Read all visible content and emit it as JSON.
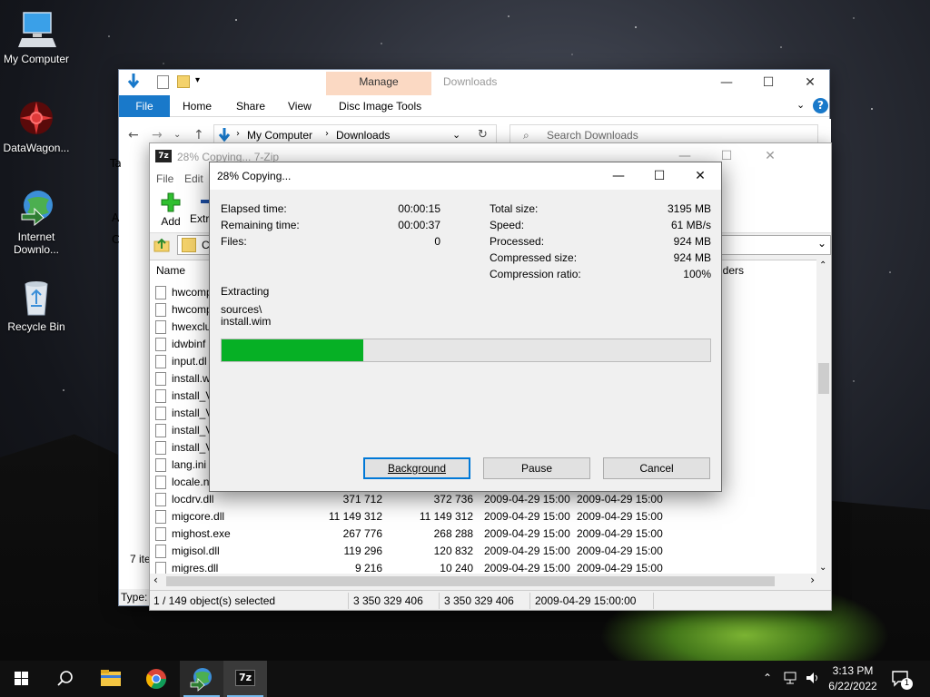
{
  "desktop": {
    "icons": [
      {
        "label": "My Computer"
      },
      {
        "label": "DataWagon..."
      },
      {
        "label": "Internet Downlo..."
      },
      {
        "label": "Recycle Bin"
      }
    ]
  },
  "explorer": {
    "title": "Downloads",
    "manage_label": "Manage",
    "tabs": [
      "File",
      "Home",
      "Share",
      "View",
      "Disc Image Tools"
    ],
    "breadcrumb": [
      "My Computer",
      "Downloads"
    ],
    "search_placeholder": "Search Downloads",
    "left_fragments": [
      "Ta",
      "A",
      "C"
    ],
    "status_left": "7 ite",
    "status_type": "Type:",
    "folders_fragment": "lders"
  },
  "sevenzip": {
    "title": "28% Copying... 7-Zip",
    "menu": [
      "File",
      "Edit"
    ],
    "toolbar": {
      "add": "Add",
      "extract": "Extr"
    },
    "path_fragment": "C",
    "column_name": "Name",
    "files": [
      {
        "name": "hwcomp",
        "size": "",
        "packed": "",
        "modified": "",
        "created": ""
      },
      {
        "name": "hwcomp",
        "size": "",
        "packed": "",
        "modified": "",
        "created": ""
      },
      {
        "name": "hwexclu",
        "size": "",
        "packed": "",
        "modified": "",
        "created": ""
      },
      {
        "name": "idwbinf",
        "size": "",
        "packed": "",
        "modified": "",
        "created": ""
      },
      {
        "name": "input.dl",
        "size": "",
        "packed": "",
        "modified": "",
        "created": ""
      },
      {
        "name": "install.w",
        "size": "",
        "packed": "",
        "modified": "",
        "created": ""
      },
      {
        "name": "install_V",
        "size": "",
        "packed": "",
        "modified": "",
        "created": ""
      },
      {
        "name": "install_V",
        "size": "",
        "packed": "",
        "modified": "",
        "created": ""
      },
      {
        "name": "install_V",
        "size": "",
        "packed": "",
        "modified": "",
        "created": ""
      },
      {
        "name": "install_V",
        "size": "",
        "packed": "",
        "modified": "",
        "created": ""
      },
      {
        "name": "lang.ini",
        "size": "",
        "packed": "",
        "modified": "",
        "created": ""
      },
      {
        "name": "locale.n",
        "size": "",
        "packed": "",
        "modified": "",
        "created": ""
      },
      {
        "name": "locdrv.dll",
        "size": "371 712",
        "packed": "372 736",
        "modified": "2009-04-29 15:00",
        "created": "2009-04-29 15:00"
      },
      {
        "name": "migcore.dll",
        "size": "11 149 312",
        "packed": "11 149 312",
        "modified": "2009-04-29 15:00",
        "created": "2009-04-29 15:00"
      },
      {
        "name": "mighost.exe",
        "size": "267 776",
        "packed": "268 288",
        "modified": "2009-04-29 15:00",
        "created": "2009-04-29 15:00"
      },
      {
        "name": "migisol.dll",
        "size": "119 296",
        "packed": "120 832",
        "modified": "2009-04-29 15:00",
        "created": "2009-04-29 15:00"
      },
      {
        "name": "migres.dll",
        "size": "9 216",
        "packed": "10 240",
        "modified": "2009-04-29 15:00",
        "created": "2009-04-29 15:00"
      }
    ],
    "status": {
      "selected": "1 / 149 object(s) selected",
      "size": "3 350 329 406",
      "packed": "3 350 329 406",
      "date": "2009-04-29 15:00:00"
    }
  },
  "dialog": {
    "title": "28% Copying...",
    "elapsed_label": "Elapsed time:",
    "elapsed": "00:00:15",
    "remaining_label": "Remaining time:",
    "remaining": "00:00:37",
    "files_label": "Files:",
    "files": "0",
    "total_size_label": "Total size:",
    "total_size": "3195 MB",
    "speed_label": "Speed:",
    "speed": "61 MB/s",
    "processed_label": "Processed:",
    "processed": "924 MB",
    "compressed_label": "Compressed size:",
    "compressed": "924 MB",
    "ratio_label": "Compression ratio:",
    "ratio": "100%",
    "operation": "Extracting",
    "current_path": "sources\\",
    "current_file": "install.wim",
    "progress_fraction": 0.29,
    "buttons": {
      "background": "Background",
      "pause": "Pause",
      "cancel": "Cancel"
    }
  },
  "taskbar": {
    "time": "3:13 PM",
    "date": "6/22/2022",
    "notification_count": "1"
  },
  "colors": {
    "progress": "#06b025",
    "file_tab": "#1979ca",
    "manage_band": "#fbd9c3",
    "accent": "#0078d7"
  }
}
